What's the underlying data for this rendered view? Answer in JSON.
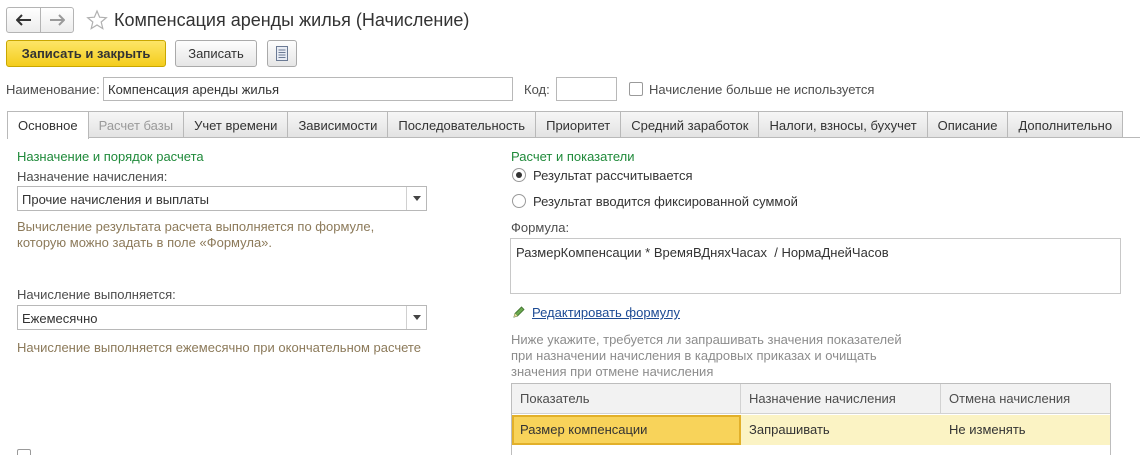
{
  "window": {
    "title": "Компенсация аренды жилья (Начисление)"
  },
  "toolbar": {
    "save_close_label": "Записать и закрыть",
    "save_label": "Записать"
  },
  "header": {
    "name_label": "Наименование:",
    "name_value": "Компенсация аренды жилья",
    "code_label": "Код:",
    "code_value": "",
    "unused_label": "Начисление больше не используется",
    "unused_checked": false
  },
  "tabs": [
    {
      "label": "Основное",
      "active": true,
      "disabled": false
    },
    {
      "label": "Расчет базы",
      "active": false,
      "disabled": true
    },
    {
      "label": "Учет времени",
      "active": false,
      "disabled": false
    },
    {
      "label": "Зависимости",
      "active": false,
      "disabled": false
    },
    {
      "label": "Последовательность",
      "active": false,
      "disabled": false
    },
    {
      "label": "Приоритет",
      "active": false,
      "disabled": false
    },
    {
      "label": "Средний заработок",
      "active": false,
      "disabled": false
    },
    {
      "label": "Налоги, взносы, бухучет",
      "active": false,
      "disabled": false
    },
    {
      "label": "Описание",
      "active": false,
      "disabled": false
    },
    {
      "label": "Дополнительно",
      "active": false,
      "disabled": false
    }
  ],
  "left": {
    "section_title": "Назначение и порядок расчета",
    "purpose_label": "Назначение начисления:",
    "purpose_value": "Прочие начисления и выплаты",
    "purpose_hint_1": "Вычисление результата расчета выполняется по формуле,",
    "purpose_hint_2": "которую можно задать в поле «Формула».",
    "frequency_label": "Начисление выполняется:",
    "frequency_value": "Ежемесячно",
    "frequency_hint": "Начисление выполняется ежемесячно при окончательном расчете"
  },
  "right": {
    "section_title": "Расчет и показатели",
    "radio_calc_label": "Результат рассчитывается",
    "radio_fixed_label": "Результат вводится фиксированной суммой",
    "selected_radio": "calc",
    "formula_label": "Формула:",
    "formula_value": "РазмерКомпенсации * ВремяВДняхЧасах  / НормаДнейЧасов",
    "edit_formula_link": "Редактировать формулу",
    "indicators_hint_1": "Ниже укажите, требуется ли запрашивать значения показателей",
    "indicators_hint_2": "при назначении начисления в кадровых приказах и очищать",
    "indicators_hint_3": "значения при отмене начисления"
  },
  "indicators_table": {
    "columns": [
      "Показатель",
      "Назначение начисления",
      "Отмена начисления"
    ],
    "rows": [
      {
        "indicator": "Размер компенсации",
        "assignment": "Запрашивать",
        "cancel": "Не изменять"
      }
    ]
  },
  "colors": {
    "primary_button": "#f4cd1c",
    "section_title": "#1f8a3a",
    "hint_text": "#8c7a5a",
    "link": "#1c4a94",
    "selected_row": "#fbf3c4",
    "selected_cell": "#f8d35a"
  },
  "icons": {
    "back": "arrow-left-icon",
    "forward": "arrow-right-icon",
    "favorite": "star-icon",
    "more": "document-list-icon",
    "edit": "pencil-icon",
    "dropdown": "chevron-down-icon"
  }
}
